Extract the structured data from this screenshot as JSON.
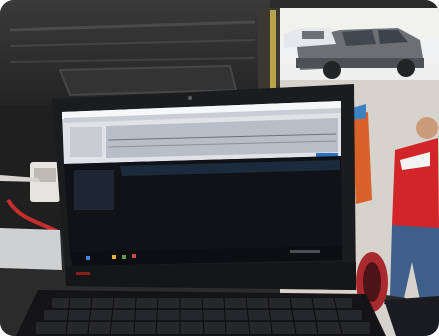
{
  "photo": {
    "subject": "laptop-in-vehicle",
    "screen_state": "on-with-dark-application-window",
    "colors": {
      "van_interior": "#2b2b2b",
      "van_panel": "#3a3a3a",
      "daylight": "#e9eaec",
      "truck_body": "#6c7075",
      "laptop_bezel": "#1b1c1e",
      "screen_titlebar": "#e6e8ec",
      "screen_body": "#101418",
      "taskbar": "#0f1216",
      "accent_red": "#d1252a",
      "keyboard": "#141416"
    },
    "icons": {
      "webcam": "webcam-icon",
      "lenovo_logo": "logo-icon"
    }
  }
}
